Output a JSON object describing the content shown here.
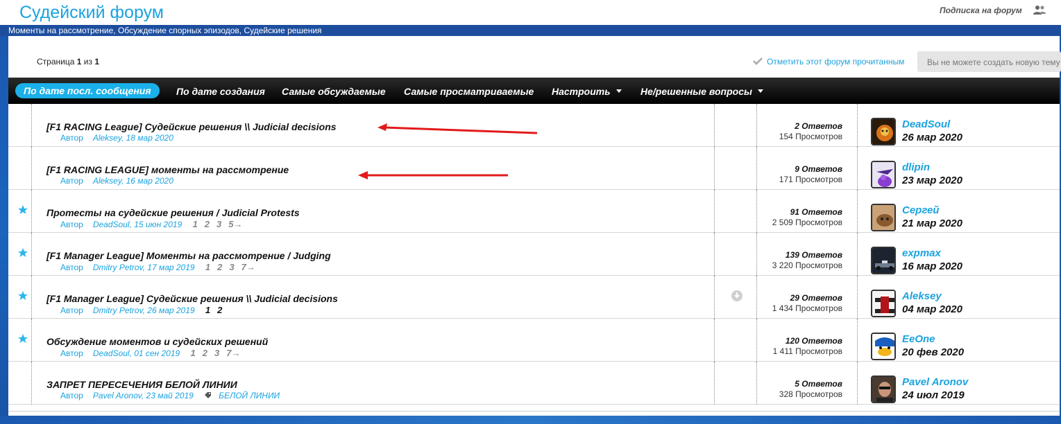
{
  "header": {
    "title": "Судейский форум",
    "subscribe": "Подписка на форум",
    "breadcrumb": "Моменты на рассмотрение, Обсуждение спорных эпизодов, Судейские решения"
  },
  "pagination": {
    "prefix": "Страница",
    "current": "1",
    "of": "из",
    "total": "1"
  },
  "actions": {
    "mark_read": "Отметить этот форум прочитанным",
    "new_topic_disabled": "Вы не можете создать новую тему"
  },
  "tabs": [
    {
      "label": "По дате посл. сообщения",
      "active": true
    },
    {
      "label": "По дате создания"
    },
    {
      "label": "Самые обсуждаемые"
    },
    {
      "label": "Самые просматриваемые"
    },
    {
      "label": "Настроить"
    },
    {
      "label": "Не/решенные вопросы"
    }
  ],
  "author_label": "Автор",
  "topics": [
    {
      "title": "[F1 RACING League] Судейские решения \\\\ Judicial decisions",
      "starter": "Aleksey, 18 мар 2020",
      "pages": [],
      "replies": "2 Ответов",
      "views": "154 Просмотров",
      "last_user": "DeadSoul",
      "last_date": "26 мар 2020",
      "starred": false
    },
    {
      "title": "[F1 RACING LEAGUE] моменты на рассмотрение",
      "starter": "Aleksey, 16 мар 2020",
      "pages": [],
      "replies": "9 Ответов",
      "views": "171 Просмотров",
      "last_user": "dlipin",
      "last_date": "23 мар 2020",
      "starred": false
    },
    {
      "title": "Протесты на судейские решения / Judicial Protests",
      "starter": "DeadSoul, 15 июн 2019",
      "pages": [
        "1",
        "2",
        "3",
        "5→"
      ],
      "replies": "91 Ответов",
      "views": "2 509 Просмотров",
      "last_user": "Сергей",
      "last_date": "21 мар 2020",
      "starred": true
    },
    {
      "title": "[F1 Manager League] Моменты на рассмотрение / Judging",
      "starter": "Dmitry Petrov, 17 мар 2019",
      "pages": [
        "1",
        "2",
        "3",
        "7→"
      ],
      "replies": "139 Ответов",
      "views": "3 220 Просмотров",
      "last_user": "expmax",
      "last_date": "16 мар 2020",
      "starred": true
    },
    {
      "title": "[F1 Manager League] Судейские решения \\\\ Judicial decisions",
      "starter": "Dmitry Petrov, 26 мар 2019",
      "pages": [
        "1",
        "2"
      ],
      "replies": "29 Ответов",
      "views": "1 434 Просмотров",
      "last_user": "Aleksey",
      "last_date": "04 мар 2020",
      "starred": true
    },
    {
      "title": "Обсуждение моментов и судейских решений",
      "starter": "DeadSoul, 01 сен 2019",
      "pages": [
        "1",
        "2",
        "3",
        "7→"
      ],
      "replies": "120 Ответов",
      "views": "1 411 Просмотров",
      "last_user": "EeOne",
      "last_date": "20 фев 2020",
      "starred": true
    },
    {
      "title": "ЗАПРЕТ ПЕРЕСЕЧЕНИЯ БЕЛОЙ ЛИНИИ",
      "starter": "Pavel Aronov, 23 май 2019",
      "tag": "БЕЛОЙ ЛИНИИ",
      "pages": [],
      "replies": "5 Ответов",
      "views": "328 Просмотров",
      "last_user": "Pavel Aronov",
      "last_date": "24 июл 2019",
      "starred": false
    }
  ],
  "colors": {
    "accent": "#1aa3df",
    "brand_blue": "#1d4e9e",
    "tab_bar": "#000000",
    "active_tab": "#1ab0ea",
    "annotation_arrow": "#e21a1a"
  }
}
